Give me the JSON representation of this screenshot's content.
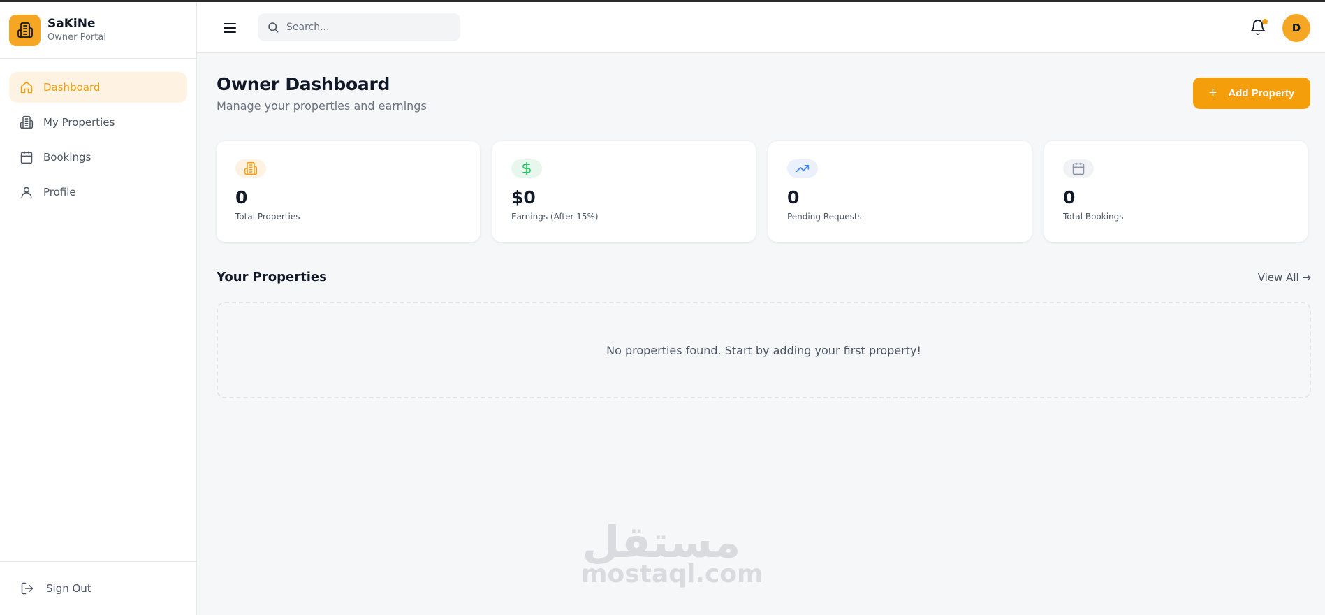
{
  "brand": {
    "name": "SaKiNe",
    "subtitle": "Owner Portal"
  },
  "sidebar": {
    "items": [
      {
        "label": "Dashboard",
        "icon": "home-icon",
        "active": true
      },
      {
        "label": "My Properties",
        "icon": "building-icon",
        "active": false
      },
      {
        "label": "Bookings",
        "icon": "calendar-icon",
        "active": false
      },
      {
        "label": "Profile",
        "icon": "user-icon",
        "active": false
      }
    ],
    "signout_label": "Sign Out"
  },
  "header": {
    "search_placeholder": "Search...",
    "avatar_initial": "D",
    "notification_dot": true
  },
  "main": {
    "title": "Owner Dashboard",
    "subtitle": "Manage your properties and earnings",
    "add_button_label": "Add Property",
    "stats": [
      {
        "value": "0",
        "label": "Total Properties",
        "icon": "building-icon",
        "color": "#f59e0b"
      },
      {
        "value": "$0",
        "label": "Earnings (After 15%)",
        "icon": "dollar-icon",
        "color": "#22c55e"
      },
      {
        "value": "0",
        "label": "Pending Requests",
        "icon": "trending-up-icon",
        "color": "#3b82f6"
      },
      {
        "value": "0",
        "label": "Total Bookings",
        "icon": "calendar-icon",
        "color": "#8b93a7"
      }
    ],
    "section_title": "Your Properties",
    "view_all_label": "View All →",
    "empty_message": "No properties found. Start by adding your first property!"
  },
  "watermark": {
    "arabic": "مستقل",
    "latin": "mostaql.com"
  },
  "colors": {
    "accent": "#f59e0b",
    "background": "#f6f7f9"
  }
}
